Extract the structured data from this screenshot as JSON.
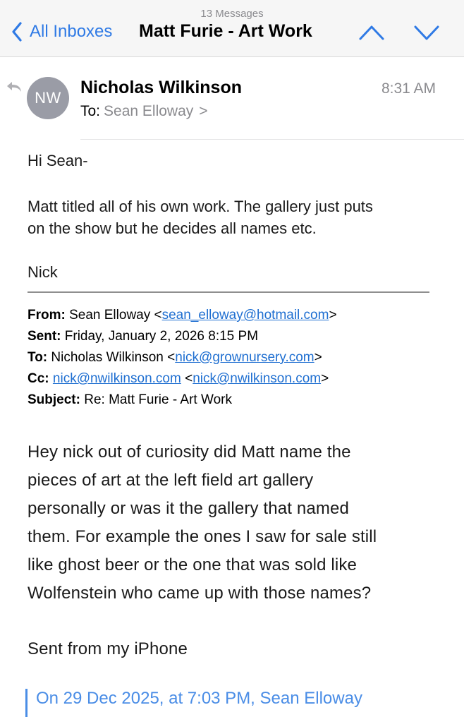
{
  "nav": {
    "message_count": "13 Messages",
    "back_label": "All Inboxes",
    "title": "Matt Furie - Art Work"
  },
  "message": {
    "avatar_initials": "NW",
    "sender": "Nicholas Wilkinson",
    "time": "8:31 AM",
    "to_label": "To:",
    "to_name": "Sean Elloway",
    "to_chevron": ">"
  },
  "body": {
    "greeting": "Hi Sean-",
    "line1": "Matt titled all of his own work.  The gallery just puts",
    "line2": "on the show but he decides all names etc.",
    "signoff": "Nick"
  },
  "quoted_header": {
    "from_label": "From:",
    "from_name": "Sean Elloway <",
    "from_email": "sean_elloway@hotmail.com",
    "from_close": ">",
    "sent_label": "Sent:",
    "sent_value": "Friday, January 2, 2026 8:15 PM",
    "to_label": "To:",
    "to_name": "Nicholas Wilkinson <",
    "to_email": "nick@grownursery.com",
    "to_close": ">",
    "cc_label": "Cc:",
    "cc_email": "nick@nwilkinson.com",
    "cc_open": " <",
    "cc_email2": "nick@nwilkinson.com",
    "cc_close": ">",
    "subject_label": "Subject:",
    "subject_value": "Re: Matt Furie - Art Work"
  },
  "reply": {
    "lines": [
      "Hey nick out of curiosity did Matt name the",
      "pieces of art at the left field art gallery",
      "personally or was it the gallery that named",
      "them. For example the ones I saw for sale still",
      "like ghost beer or the one that was sold like",
      "Wolfenstein who came up with those names?"
    ],
    "signature": "Sent from my iPhone",
    "quoted_preview": "On 29 Dec 2025, at 7:03 PM, Sean Elloway"
  },
  "colors": {
    "accent": "#2f7ae5",
    "link": "#1f6fd1",
    "avatar_bg": "#9a9ca6",
    "secondary_text": "#8a8a8e"
  },
  "icons": {
    "back": "chevron-left-icon",
    "prev": "chevron-up-icon",
    "next": "chevron-down-icon",
    "replied": "reply-arrow-icon"
  }
}
